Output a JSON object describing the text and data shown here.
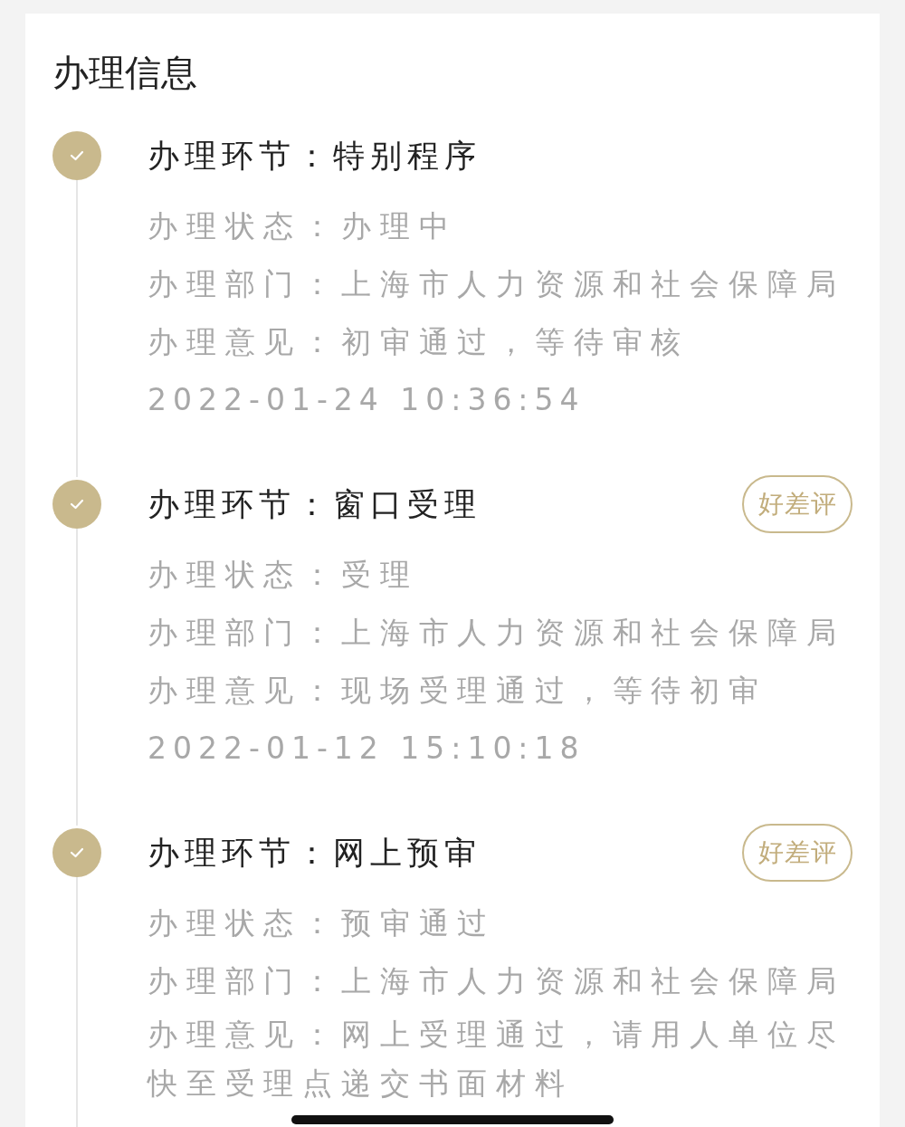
{
  "title": "办理信息",
  "steps": [
    {
      "done": true,
      "heading": "办理环节：特别程序",
      "details": [
        "办理状态：办理中",
        "办理部门：上海市人力资源和社会保障局",
        "办理意见：初审通过，等待审核"
      ],
      "date": "2022-01-24 10:36:54"
    },
    {
      "done": true,
      "heading": "办理环节：窗口受理",
      "rating_button": "好差评",
      "details": [
        "办理状态：受理",
        "办理部门：上海市人力资源和社会保障局",
        "办理意见：现场受理通过，等待初审"
      ],
      "date": "2022-01-12 15:10:18"
    },
    {
      "done": true,
      "heading": "办理环节：网上预审",
      "rating_button": "好差评",
      "details": [
        "办理状态：预审通过",
        "办理部门：上海市人力资源和社会保障局",
        "办理意见：网上受理通过，请用人单位尽快至受理点递交书面材料"
      ]
    }
  ]
}
